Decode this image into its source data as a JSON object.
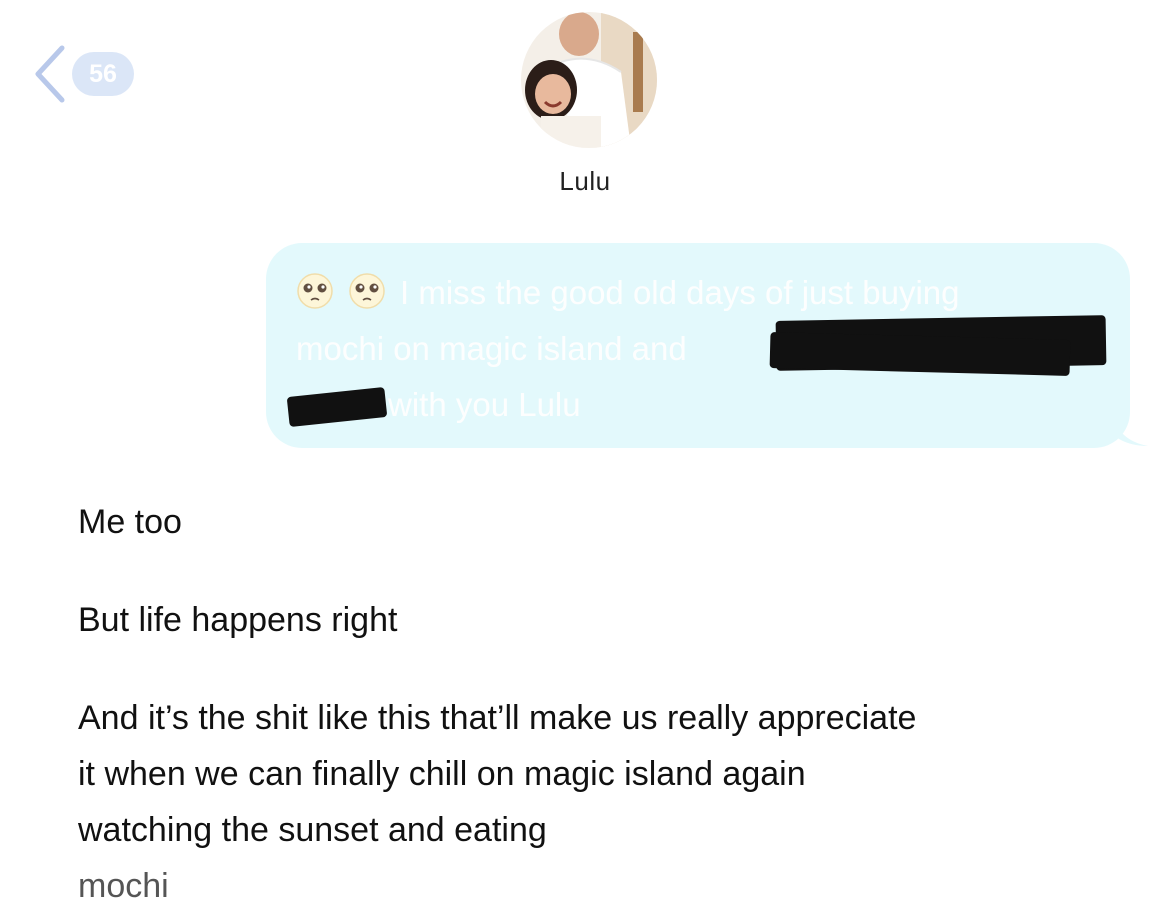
{
  "header": {
    "back_count": "56",
    "contact_name": "Lulu"
  },
  "thread": {
    "sent": {
      "emojis": [
        "pleading-face",
        "pleading-face"
      ],
      "line1": "I miss the good old days of just buying",
      "line2": "mochi on magic island and",
      "line3": "with you Lulu"
    },
    "received": [
      "Me too",
      "But life happens right",
      "And it’s the shit like this that’ll make us really appreciate it when we can finally chill on magic island again watching the sunset and eating",
      "mochi"
    ]
  },
  "colors": {
    "sent_bubble": "#e3f9fc",
    "badge": "#dbe6f7",
    "back_chevron": "#b8c8ea"
  }
}
